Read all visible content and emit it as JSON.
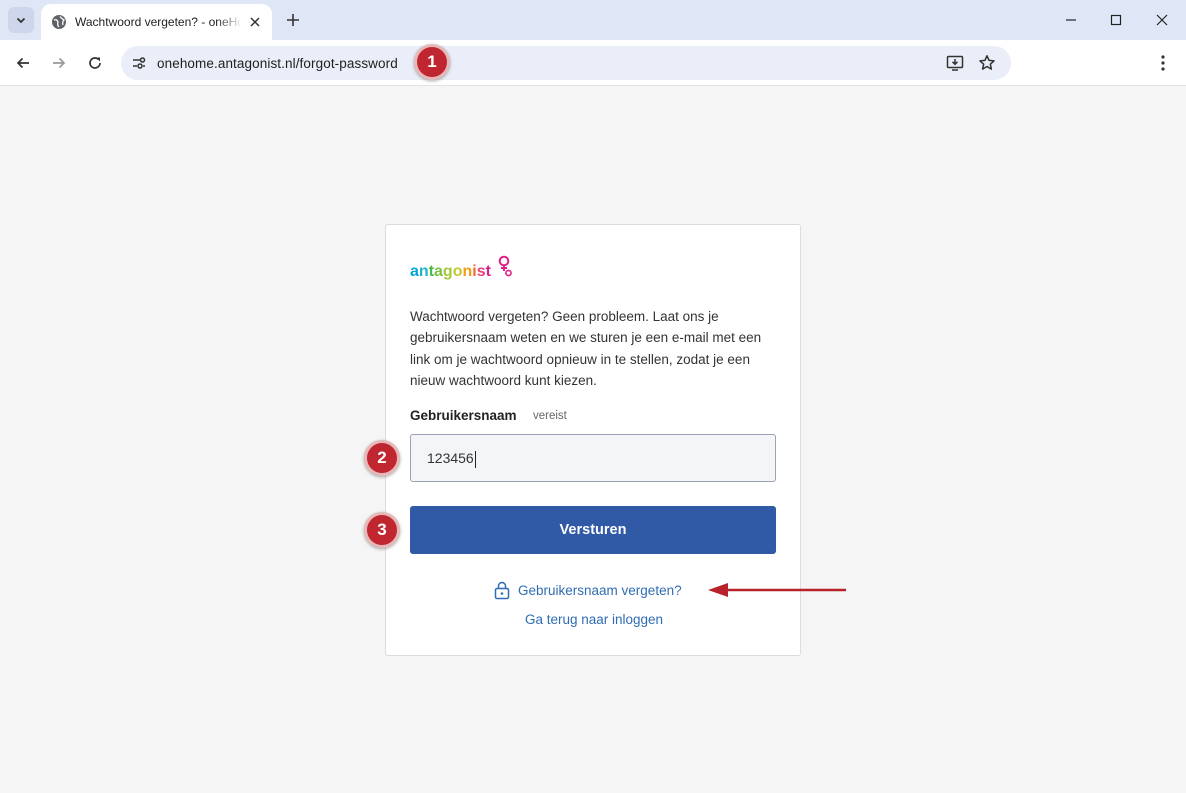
{
  "browser": {
    "tab_title": "Wachtwoord vergeten? - oneHome",
    "url": "onehome.antagonist.nl/forgot-password"
  },
  "colors": {
    "primary_button": "#3059a6",
    "link": "#2f6db3",
    "annotation": "#c0262f"
  },
  "logo": {
    "text": "antagonist"
  },
  "form": {
    "intro": "Wachtwoord vergeten? Geen probleem. Laat ons je gebruikersnaam weten en we sturen je een e-mail met een link om je wachtwoord opnieuw in te stellen, zodat je een nieuw wachtwoord kunt kiezen.",
    "username_label": "Gebruikersnaam",
    "username_required": "vereist",
    "username_value": "123456",
    "submit_label": "Versturen",
    "forgot_username_link": "Gebruikersnaam vergeten?",
    "back_to_login_link": "Ga terug naar inloggen"
  },
  "annotations": {
    "badge_1": "1",
    "badge_2": "2",
    "badge_3": "3"
  },
  "icons": [
    "tab-search-icon",
    "globe-icon",
    "close-icon",
    "plus-icon",
    "minimize-icon",
    "maximize-icon",
    "window-close-icon",
    "back-arrow-icon",
    "forward-arrow-icon",
    "reload-icon",
    "site-settings-icon",
    "install-app-icon",
    "bookmark-star-icon",
    "kebab-menu-icon",
    "lock-icon",
    "red-arrow-icon"
  ]
}
